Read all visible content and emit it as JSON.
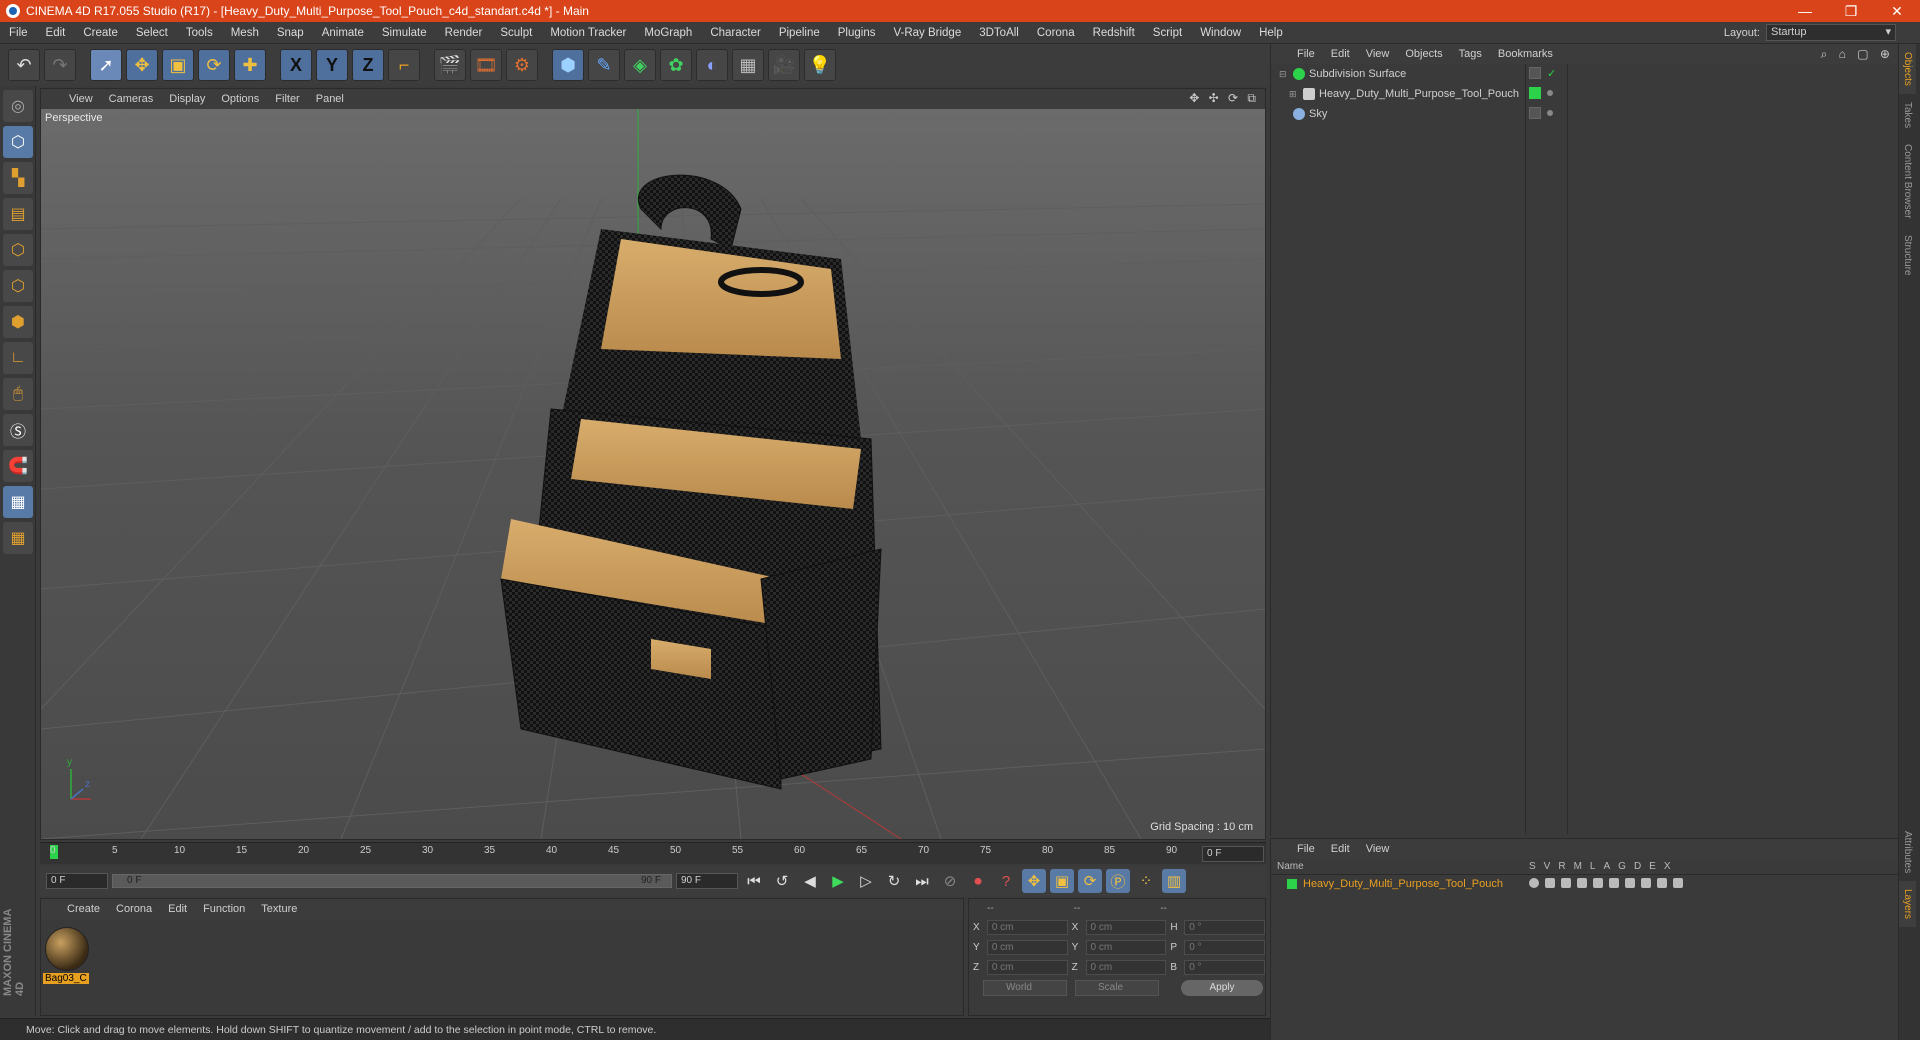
{
  "window": {
    "title": "CINEMA 4D R17.055 Studio (R17) - [Heavy_Duty_Multi_Purpose_Tool_Pouch_c4d_standart.c4d *] - Main",
    "minimize": "—",
    "restore": "❐",
    "close": "✕"
  },
  "menubar": {
    "items": [
      "File",
      "Edit",
      "Create",
      "Select",
      "Tools",
      "Mesh",
      "Snap",
      "Animate",
      "Simulate",
      "Render",
      "Sculpt",
      "Motion Tracker",
      "MoGraph",
      "Character",
      "Pipeline",
      "Plugins",
      "V-Ray Bridge",
      "3DToAll",
      "Corona",
      "Redshift",
      "Script",
      "Window",
      "Help"
    ],
    "layout_label": "Layout:",
    "layout_value": "Startup"
  },
  "toolbar": {
    "icons": [
      "undo-icon",
      "redo-icon",
      "live-select-icon",
      "move-icon",
      "scale-icon",
      "rotate-icon",
      "add-icon",
      "x-axis-icon",
      "y-axis-icon",
      "z-axis-icon",
      "coordinate-system-icon",
      "render-view-icon",
      "render-picture-viewer-icon",
      "edit-render-settings-icon",
      "cube-icon",
      "pen-icon",
      "subdivision-icon",
      "cloner-icon",
      "deformer-icon",
      "floor-icon",
      "camera-icon",
      "light-icon"
    ],
    "x_label": "X",
    "y_label": "Y",
    "z_label": "Z"
  },
  "viewport": {
    "menu": [
      "View",
      "Cameras",
      "Display",
      "Options",
      "Filter",
      "Panel"
    ],
    "nav_icons": "✥ ✣ ⟳ ⧉",
    "label": "Perspective",
    "grid_spacing": "Grid Spacing : 10 cm",
    "axis_y": "y",
    "axis_z": "z"
  },
  "timeline": {
    "ticks": [
      "0",
      "5",
      "10",
      "15",
      "20",
      "25",
      "30",
      "35",
      "40",
      "45",
      "50",
      "55",
      "60",
      "65",
      "70",
      "75",
      "80",
      "85",
      "90"
    ],
    "current_frame": "0 F"
  },
  "transport": {
    "start_frame": "0 F",
    "range_start": "0 F",
    "range_end": "90 F",
    "end_frame": "90 F"
  },
  "material_panel": {
    "menu": [
      "Create",
      "Corona",
      "Edit",
      "Function",
      "Texture"
    ],
    "material_name": "Bag03_C"
  },
  "coords": {
    "head": [
      "--",
      "--",
      "--"
    ],
    "rows": [
      {
        "a1": "X",
        "v1": "0 cm",
        "a2": "X",
        "v2": "0 cm",
        "a3": "H",
        "v3": "0 °"
      },
      {
        "a1": "Y",
        "v1": "0 cm",
        "a2": "Y",
        "v2": "0 cm",
        "a3": "P",
        "v3": "0 °"
      },
      {
        "a1": "Z",
        "v1": "0 cm",
        "a2": "Z",
        "v2": "0 cm",
        "a3": "B",
        "v3": "0 °"
      }
    ],
    "space": "World",
    "mode": "Scale",
    "apply": "Apply"
  },
  "statusbar": {
    "text": "Move: Click and drag to move elements. Hold down SHIFT to quantize movement / add to the selection in point mode, CTRL to remove."
  },
  "object_manager": {
    "menu": [
      "File",
      "Edit",
      "View",
      "Objects",
      "Tags",
      "Bookmarks"
    ],
    "tools": "⌕ ⌂ ▢ ⊕",
    "objects": [
      {
        "name": "Subdivision Surface",
        "icon_color": "#2bd24a"
      },
      {
        "name": "Heavy_Duty_Multi_Purpose_Tool_Pouch",
        "icon_color": "#cfcfcf"
      },
      {
        "name": "Sky",
        "icon_color": "#8ab0e0"
      }
    ]
  },
  "right_tabs": [
    "Objects",
    "Takes",
    "Content Browser",
    "Structure"
  ],
  "right_tabs_bottom": [
    "Attributes",
    "Layers"
  ],
  "layer_panel": {
    "menu": [
      "File",
      "Edit",
      "View"
    ],
    "name_header": "Name",
    "columns": [
      "S",
      "V",
      "R",
      "M",
      "L",
      "A",
      "G",
      "D",
      "E",
      "X"
    ],
    "layer_name": "Heavy_Duty_Multi_Purpose_Tool_Pouch"
  },
  "colors": {
    "title_bar": "#d9441a",
    "accent_orange": "#e8a020",
    "layer_green": "#2bd24a"
  }
}
